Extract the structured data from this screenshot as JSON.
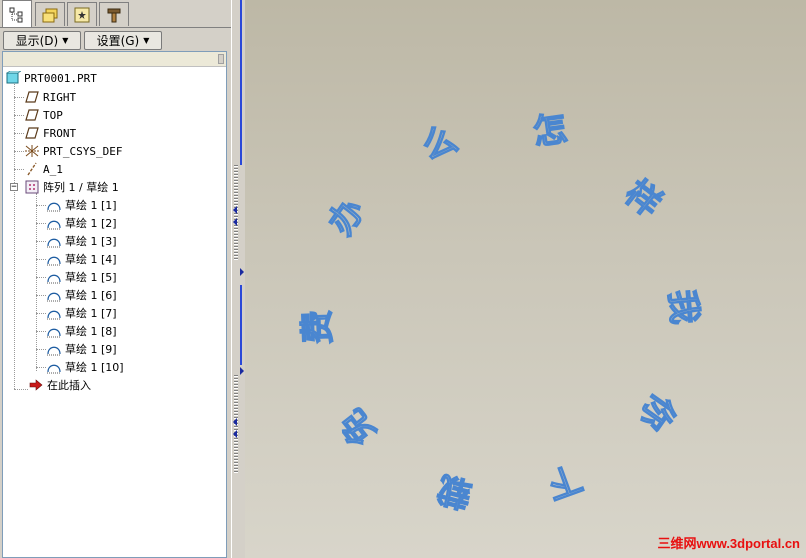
{
  "tabs": [
    {
      "icon": "model-tree-icon",
      "active": true
    },
    {
      "icon": "folder-browser-icon",
      "active": false
    },
    {
      "icon": "favorites-icon",
      "active": false
    },
    {
      "icon": "connections-icon",
      "active": false
    }
  ],
  "toolbar": {
    "display_label": "显示(D)",
    "settings_label": "设置(G)"
  },
  "tree": {
    "root": "PRT0001.PRT",
    "datums": [
      {
        "label": "RIGHT",
        "icon": "datum-plane-icon"
      },
      {
        "label": "TOP",
        "icon": "datum-plane-icon"
      },
      {
        "label": "FRONT",
        "icon": "datum-plane-icon"
      },
      {
        "label": "PRT_CSYS_DEF",
        "icon": "coordinate-system-icon"
      },
      {
        "label": "A_1",
        "icon": "datum-axis-icon"
      }
    ],
    "pattern": {
      "label": "阵列 1 / 草绘 1",
      "expanded": true,
      "children": [
        "草绘 1 [1]",
        "草绘 1 [2]",
        "草绘 1 [3]",
        "草绘 1 [4]",
        "草绘 1 [5]",
        "草绘 1 [6]",
        "草绘 1 [7]",
        "草绘 1 [8]",
        "草绘 1 [9]",
        "草绘 1 [10]"
      ]
    },
    "insert_here": "在此插入"
  },
  "graphics": {
    "characters": [
      "怎",
      "样",
      "我",
      "你",
      "下",
      "载",
      "免",
      "费",
      "办",
      "么"
    ],
    "outline_color": "#4a86d0"
  },
  "watermark": "三维网www.3dportal.cn",
  "colors": {
    "panel_bg": "#d4d0c8",
    "tree_bg": "#ffffff",
    "graphics_top": "#bdb8a6",
    "graphics_bottom": "#d8d5ca",
    "watermark": "#e81010"
  }
}
